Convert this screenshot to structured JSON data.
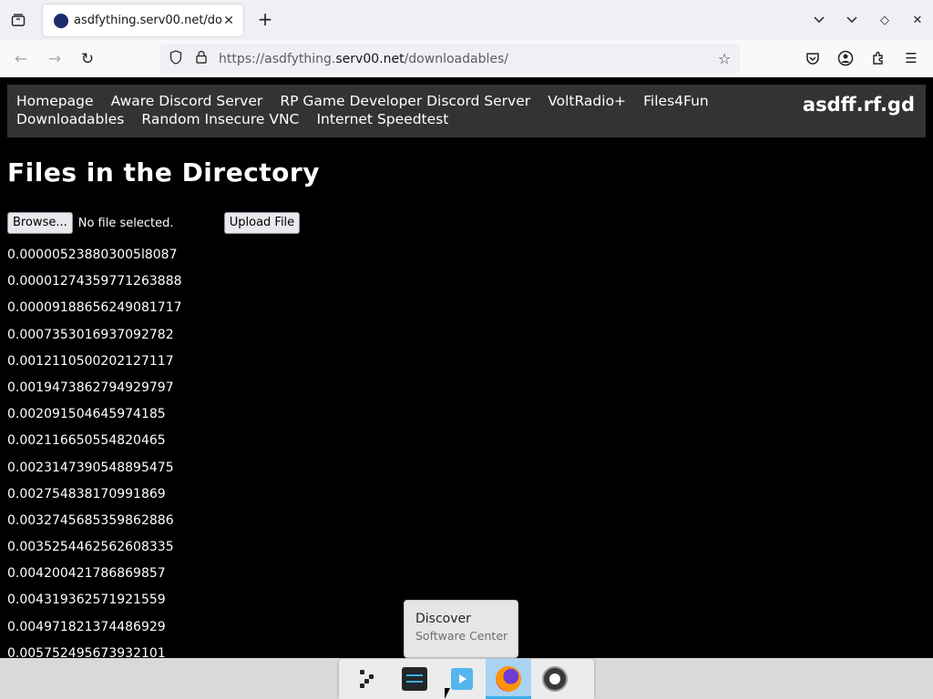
{
  "browser": {
    "tab_title": "asdfything.serv00.net/dow",
    "url_prefix": "https://asdfything.",
    "url_domain": "serv00.net",
    "url_path": "/downloadables/"
  },
  "site": {
    "nav_links": [
      "Homepage",
      "Aware Discord Server",
      "RP Game Developer Discord Server",
      "VoltRadio+",
      "Files4Fun",
      "Downloadables",
      "Random Insecure VNC",
      "Internet Speedtest"
    ],
    "brand": "asdff.rf.gd",
    "heading": "Files in the Directory",
    "browse_label": "Browse...",
    "no_file_text": "No file selected.",
    "upload_label": "Upload File",
    "files": [
      "0.000005238803005l8087",
      "0.00001274359771263888",
      "0.00009188656249081717",
      "0.0007353016937092782",
      "0.0012110500202127117",
      "0.0019473862794929797",
      "0.002091504645974185",
      "0.002116650554820465",
      "0.0023147390548895475",
      "0.002754838170991869",
      "0.0032745685359862886",
      "0.0035254462562608335",
      "0.004200421786869857",
      "0.004319362571921559",
      "0.004971821374486929",
      "0.005752495673932101"
    ]
  },
  "tooltip": {
    "title": "Discover",
    "subtitle": "Software Center"
  },
  "colors": {
    "page_bg": "#000000",
    "nav_bg": "#333333",
    "taskbar_active": "#a9d3f2"
  }
}
